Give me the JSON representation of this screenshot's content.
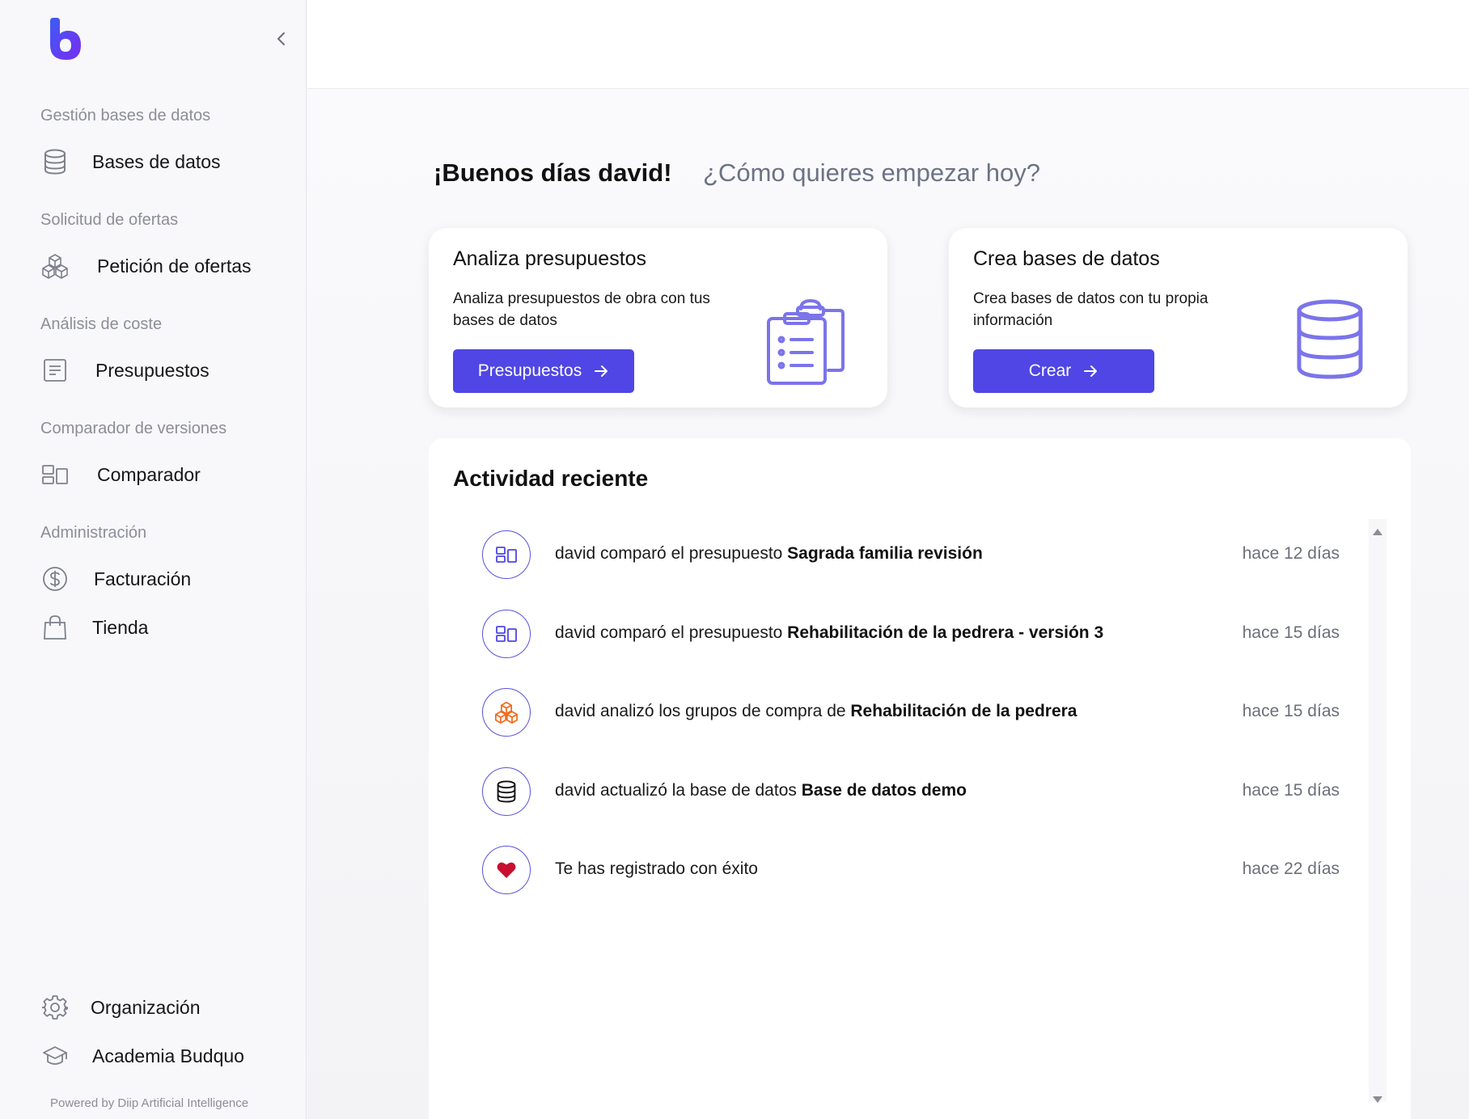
{
  "sidebar": {
    "sections": [
      {
        "title": "Gestión bases de datos",
        "items": [
          {
            "label": "Bases de datos",
            "icon": "database-icon"
          }
        ]
      },
      {
        "title": "Solicitud de ofertas",
        "items": [
          {
            "label": "Petición de ofertas",
            "icon": "cubes-icon"
          }
        ]
      },
      {
        "title": "Análisis de coste",
        "items": [
          {
            "label": "Presupuestos",
            "icon": "document-icon"
          }
        ]
      },
      {
        "title": "Comparador de versiones",
        "items": [
          {
            "label": "Comparador",
            "icon": "compare-icon"
          }
        ]
      },
      {
        "title": "Administración",
        "items": [
          {
            "label": "Facturación",
            "icon": "dollar-icon"
          },
          {
            "label": "Tienda",
            "icon": "shopping-bag-icon"
          }
        ]
      }
    ],
    "bottom_items": [
      {
        "label": "Organización",
        "icon": "gear-icon"
      },
      {
        "label": "Academia Budquo",
        "icon": "graduation-cap-icon"
      }
    ],
    "powered_by": "Powered by Diip Artificial Intelligence"
  },
  "greeting": {
    "title": "¡Buenos días david!",
    "subtitle": "¿Cómo quieres empezar hoy?"
  },
  "cards": [
    {
      "title": "Analiza presupuestos",
      "description": "Analiza presupuestos de obra con tus bases de datos",
      "button": "Presupuestos",
      "icon": "clipboard-list-icon"
    },
    {
      "title": "Crea bases de datos",
      "description": "Crea bases de datos con tu propia información",
      "button": "Crear",
      "icon": "database-icon"
    }
  ],
  "activity": {
    "title": "Actividad reciente",
    "items": [
      {
        "prefix": "david comparó el presupuesto ",
        "subject": "Sagrada familia revisión",
        "time": "hace 12 días",
        "icon": "compare-icon"
      },
      {
        "prefix": "david comparó el presupuesto ",
        "subject": "Rehabilitación de la pedrera - versión 3",
        "time": "hace 15 días",
        "icon": "compare-icon"
      },
      {
        "prefix": "david analizó los grupos de compra de ",
        "subject": "Rehabilitación de la pedrera",
        "time": "hace 15 días",
        "icon": "cubes-icon"
      },
      {
        "prefix": "david actualizó la base de datos ",
        "subject": "Base de datos demo",
        "time": "hace 15 días",
        "icon": "database-icon"
      },
      {
        "prefix": "Te has registrado con éxito",
        "subject": "",
        "time": "hace 22 días",
        "icon": "heart-icon"
      }
    ]
  },
  "colors": {
    "accent": "#4f46e5",
    "cubes_orange": "#f26b1d",
    "heart_red": "#c8102e",
    "muted_text": "#8c8e98"
  }
}
